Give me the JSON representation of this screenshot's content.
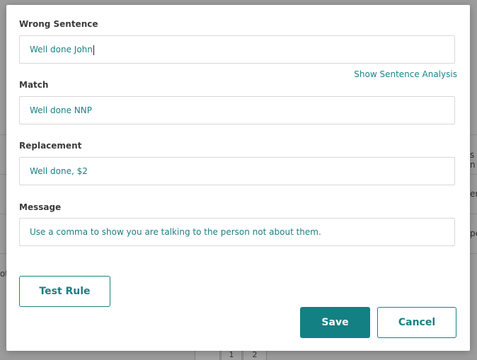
{
  "background": {
    "fragments": [
      "s n",
      "er",
      "pe",
      "ot"
    ],
    "pager": [
      "",
      "1",
      "2"
    ]
  },
  "modal": {
    "wrong_sentence": {
      "label": "Wrong Sentence",
      "value": "Well done John"
    },
    "analysis_link": "Show Sentence Analysis",
    "match": {
      "label": "Match",
      "value": "Well done NNP"
    },
    "replacement": {
      "label": "Replacement",
      "value": "Well done, $2"
    },
    "message": {
      "label": "Message",
      "value": "Use a comma to show you are talking to the person not about them."
    },
    "buttons": {
      "test": "Test Rule",
      "save": "Save",
      "cancel": "Cancel"
    }
  },
  "colors": {
    "accent": "#138083",
    "text_accent": "#1a7f82",
    "overlay": "#9c9c9c"
  }
}
